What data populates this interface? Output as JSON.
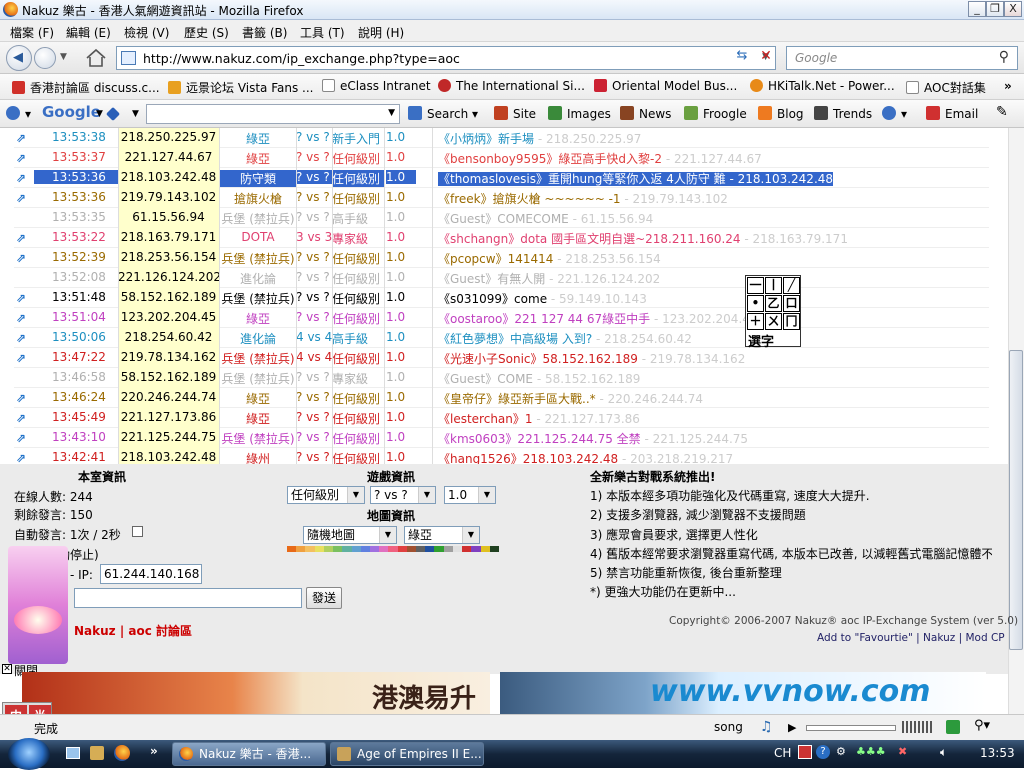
{
  "window": {
    "title": "Nakuz 樂古 - 香港人氣網遊資訊站 - Mozilla Firefox",
    "minimize": "_",
    "restore": "❐",
    "close": "X"
  },
  "menu": [
    "檔案 (F)",
    "編輯 (E)",
    "檢視 (V)",
    "歷史 (S)",
    "書籤 (B)",
    "工具 (T)",
    "說明 (H)"
  ],
  "nav": {
    "url": "http://www.nakuz.com/ip_exchange.php?type=aoc",
    "search_placeholder": "Google"
  },
  "bookmarks": [
    {
      "label": "香港討論區 discuss.c...",
      "color": "#d0302a"
    },
    {
      "label": "远景论坛 Vista Fans ...",
      "color": "#e8a020"
    },
    {
      "label": "eClass Intranet",
      "color": "#ffffff"
    },
    {
      "label": "The International Si...",
      "color": "#c02828"
    },
    {
      "label": "Oriental Model Bus...",
      "color": "#cc2233"
    },
    {
      "label": "HKiTalk.Net - Power...",
      "color": "#e88a18"
    },
    {
      "label": "AOC對話集",
      "color": "#ffffff"
    }
  ],
  "gtoolbar": {
    "google": "Google",
    "items": [
      {
        "label": "Search",
        "color": "#3a6fc4"
      },
      {
        "label": "Site",
        "color": "#c04020"
      },
      {
        "label": "Images",
        "color": "#3a8a3a"
      },
      {
        "label": "News",
        "color": "#884422"
      },
      {
        "label": "Froogle",
        "color": "#6aa040"
      },
      {
        "label": "Blog",
        "color": "#ee7a20"
      },
      {
        "label": "Trends",
        "color": "#444444"
      },
      {
        "label": "Email",
        "color": "#d03030"
      }
    ]
  },
  "rows": [
    {
      "time": "13:53:38",
      "ip": "218.250.225.97",
      "civ": "綠亞",
      "vs": "? vs ?",
      "level": "新手入門",
      "ver": "1.0",
      "msg": "《小炳炳》新手場",
      "gip": " - 218.250.225.97",
      "color": "#1d8fc0",
      "civcolor": "#1d8fc0",
      "icon": true
    },
    {
      "time": "13:53:37",
      "ip": "221.127.44.67",
      "civ": "綠亞",
      "vs": "? vs ?",
      "level": "任何級別",
      "ver": "1.0",
      "msg": "《bensonboy9595》綠亞高手快d入黎-2",
      "gip": " - 221.127.44.67",
      "color": "#e04040",
      "civcolor": "#e04040",
      "icon": true
    },
    {
      "time": "13:53:36",
      "ip": "218.103.242.48",
      "civ": "防守類",
      "vs": "? vs ?",
      "level": "任何級別",
      "ver": "1.0",
      "msg": "《thomaslovesis》重開hung等緊你入返 4人防守 難 - 218.103.242.48",
      "gip": "",
      "color": "#ffffff",
      "civcolor": "#ffffff",
      "icon": true,
      "selected": true
    },
    {
      "time": "13:53:36",
      "ip": "219.79.143.102",
      "civ": "搶旗火槍",
      "vs": "? vs ?",
      "level": "任何級別",
      "ver": "1.0",
      "msg": "《freek》搶旗火槍 ~~~~~~ -1",
      "gip": " - 219.79.143.102",
      "color": "#9a6a00",
      "civcolor": "#9a6a00",
      "icon": true
    },
    {
      "time": "13:53:35",
      "ip": "61.15.56.94",
      "civ": "兵堡 (禁拉兵)",
      "vs": "? vs ?",
      "level": "高手級",
      "ver": "1.0",
      "msg": "《Guest》COMECOME",
      "gip": " - 61.15.56.94",
      "color": "#b0b0b0",
      "civcolor": "#b0b0b0",
      "icon": false
    },
    {
      "time": "13:53:22",
      "ip": "218.163.79.171",
      "civ": "DOTA",
      "vs": "3 vs 3",
      "level": "專家級",
      "ver": "1.0",
      "msg": "《shchangn》dota 國手區文明自選~218.211.160.24",
      "gip": " - 218.163.79.171",
      "color": "#e04070",
      "civcolor": "#e04070",
      "icon": true
    },
    {
      "time": "13:52:39",
      "ip": "218.253.56.154",
      "civ": "兵堡 (禁拉兵)",
      "vs": "? vs ?",
      "level": "任何級別",
      "ver": "1.0",
      "msg": "《pcopcw》141414",
      "gip": " - 218.253.56.154",
      "color": "#9a6a00",
      "civcolor": "#9a6a00",
      "icon": true
    },
    {
      "time": "13:52:08",
      "ip": "221.126.124.202",
      "civ": "進化論",
      "vs": "? vs ?",
      "level": "任何級別",
      "ver": "1.0",
      "msg": "《Guest》有無人開",
      "gip": " - 221.126.124.202",
      "color": "#b0b0b0",
      "civcolor": "#b0b0b0",
      "icon": false
    },
    {
      "time": "13:51:48",
      "ip": "58.152.162.189",
      "civ": "兵堡 (禁拉兵)",
      "vs": "? vs ?",
      "level": "任何級別",
      "ver": "1.0",
      "msg": "《s031099》come",
      "gip": " - 59.149.10.143",
      "color": "#000000",
      "civcolor": "#000000",
      "icon": true
    },
    {
      "time": "13:51:04",
      "ip": "123.202.204.45",
      "civ": "綠亞",
      "vs": "? vs ?",
      "level": "任何級別",
      "ver": "1.0",
      "msg": "《oostaroo》221 127 44 67綠亞中手",
      "gip": " - 123.202.204.45",
      "color": "#c040c0",
      "civcolor": "#c040c0",
      "icon": true
    },
    {
      "time": "13:50:06",
      "ip": "218.254.60.42",
      "civ": "進化論",
      "vs": "4 vs 4",
      "level": "高手級",
      "ver": "1.0",
      "msg": "《紅色夢想》中高級場 入到?",
      "gip": " - 218.254.60.42",
      "color": "#1d8fc0",
      "civcolor": "#1d8fc0",
      "icon": true
    },
    {
      "time": "13:47:22",
      "ip": "219.78.134.162",
      "civ": "兵堡 (禁拉兵)",
      "vs": "4 vs 4",
      "level": "任何級別",
      "ver": "1.0",
      "msg": "《光速小子Sonic》58.152.162.189",
      "gip": " - 219.78.134.162",
      "color": "#d02020",
      "civcolor": "#d02020",
      "icon": true
    },
    {
      "time": "13:46:58",
      "ip": "58.152.162.189",
      "civ": "兵堡 (禁拉兵)",
      "vs": "? vs ?",
      "level": "專家級",
      "ver": "1.0",
      "msg": "《Guest》COME",
      "gip": " - 58.152.162.189",
      "color": "#b0b0b0",
      "civcolor": "#b0b0b0",
      "icon": false
    },
    {
      "time": "13:46:24",
      "ip": "220.246.244.74",
      "civ": "綠亞",
      "vs": "? vs ?",
      "level": "任何級別",
      "ver": "1.0",
      "msg": "《皇帝仔》綠亞新手區大戰..*",
      "gip": " - 220.246.244.74",
      "color": "#9a6a00",
      "civcolor": "#9a6a00",
      "icon": true
    },
    {
      "time": "13:45:49",
      "ip": "221.127.173.86",
      "civ": "綠亞",
      "vs": "? vs ?",
      "level": "任何級別",
      "ver": "1.0",
      "msg": "《lesterchan》1",
      "gip": " - 221.127.173.86",
      "color": "#d02020",
      "civcolor": "#d02020",
      "icon": true
    },
    {
      "time": "13:43:10",
      "ip": "221.125.244.75",
      "civ": "兵堡 (禁拉兵)",
      "vs": "? vs ?",
      "level": "任何級別",
      "ver": "1.0",
      "msg": "《kms0603》221.125.244.75 全禁",
      "gip": " - 221.125.244.75",
      "color": "#c040c0",
      "civcolor": "#c040c0",
      "icon": true
    },
    {
      "time": "13:42:41",
      "ip": "218.103.242.48",
      "civ": "綠州",
      "vs": "? vs ?",
      "level": "任何級別",
      "ver": "1.0",
      "msg": "《hang1526》218.103.242.48",
      "gip": " - 203.218.219.217",
      "color": "#d02020",
      "civcolor": "#d02020",
      "icon": true
    }
  ],
  "room": {
    "heading": "本室資訊",
    "online_label": "在線人數:",
    "online": "244",
    "remaining_label": "剩餘發言:",
    "remaining": "150",
    "auto_label": "自動發言: 1次 / 2秒",
    "auto_stop": "發自動停止)",
    "ip_label": "- IP:",
    "ip_value": "61.244.140.168",
    "send_label": "發送",
    "links": "Nakuz | aoc 討論區",
    "close_label": "關閉"
  },
  "game": {
    "heading": "遊戲資訊",
    "level": "任何級別",
    "vs": "? vs ?",
    "version": "1.0",
    "map_heading": "地圖資訊",
    "map": "隨機地圖",
    "civ": "綠亞",
    "palette": [
      "#e86a18",
      "#f0a040",
      "#f4c060",
      "#e8e060",
      "#b0d060",
      "#7ac060",
      "#60b0a0",
      "#60a0d0",
      "#6080e0",
      "#a070e0",
      "#e070c0",
      "#f06080",
      "#e04040",
      "#a05030",
      "#606060",
      "#2050a0",
      "#30a030",
      "#a0a0a0",
      "#e0e0e0",
      "#d03030",
      "#8040c0",
      "#e0c020",
      "#204020"
    ]
  },
  "news": {
    "heading": "全新樂古對戰系統推出!",
    "items": [
      "1) 本版本經多項功能強化及代碼重寫, 速度大大提升.",
      "2) 支援多瀏覽器, 減少瀏覽器不支援問題",
      "3) 應眾會員要求, 選擇更人性化",
      "4) 舊版本經常要求瀏覽器重寫代碼, 本版本已改善, 以減輕舊式電腦記憶體不",
      "5) 禁言功能重新恢復, 後台重新整理",
      "*) 更強大功能仍在更新中..."
    ],
    "copyright": "Copyright© 2006-2007  Nakuz® aoc IP-Exchange System (ver 5.0)",
    "footer_links": "Add to \"Favourtie\"  |  Nakuz  |  Mod CP"
  },
  "ads": {
    "left": "港澳易升",
    "right": "www.vvnow.com"
  },
  "status": {
    "text": "完成",
    "song": "song"
  },
  "ime": {
    "c1": "中",
    "c2": "半",
    "kb": [
      "一",
      "丨",
      "╱",
      "•",
      "乙",
      "口",
      "＋",
      "ㄨ",
      "冂"
    ],
    "label": "選字",
    "keys": [
      "CH"
    ]
  },
  "taskbar": {
    "task1": "Nakuz 樂古 - 香港...",
    "task2": "Age of Empires II E...",
    "clock": "13:53",
    "lang": "CH"
  }
}
